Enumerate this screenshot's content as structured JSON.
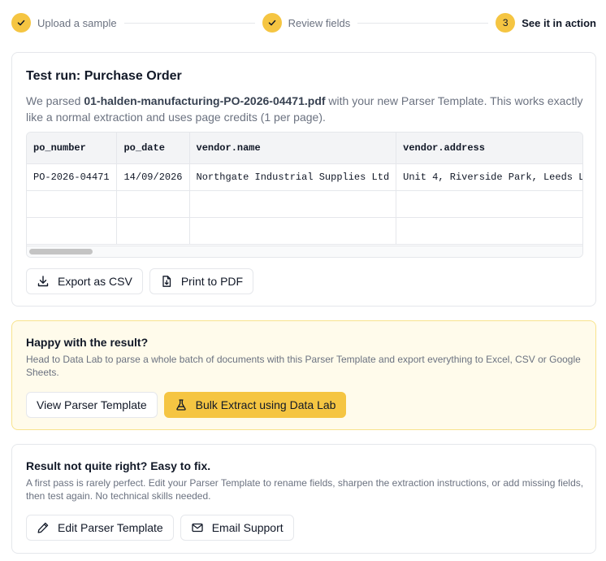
{
  "stepper": {
    "steps": [
      {
        "label": "Upload a sample",
        "state": "complete",
        "icon": "check-icon"
      },
      {
        "label": "Review fields",
        "state": "complete",
        "icon": "check-icon"
      },
      {
        "label": "See it in action",
        "state": "active",
        "number": "3"
      }
    ]
  },
  "test_run": {
    "title": "Test run: Purchase Order",
    "desc_prefix": "We parsed ",
    "filename": "01-halden-manufacturing-PO-2026-04471.pdf",
    "desc_suffix": " with your new Parser Template. This works exactly like a normal extraction and uses page credits (1 per page).",
    "table": {
      "columns": [
        "po_number",
        "po_date",
        "vendor.name",
        "vendor.address"
      ],
      "rows": [
        [
          "PO-2026-04471",
          "14/09/2026",
          "Northgate Industrial Supplies Ltd",
          "Unit 4, Riverside Park, Leeds L"
        ],
        [
          "",
          "",
          "",
          ""
        ],
        [
          "",
          "",
          "",
          ""
        ]
      ]
    },
    "buttons": {
      "export_csv": "Export as CSV",
      "print_pdf": "Print to PDF"
    }
  },
  "happy": {
    "title": "Happy with the result?",
    "desc": "Head to Data Lab to parse a whole batch of documents with this Parser Template and export everything to Excel, CSV or Google Sheets.",
    "buttons": {
      "view_template": "View Parser Template",
      "bulk_extract": "Bulk Extract using Data Lab"
    }
  },
  "fix": {
    "title": "Result not quite right? Easy to fix.",
    "desc": "A first pass is rarely perfect. Edit your Parser Template to rename fields, sharpen the extraction instructions, or add missing fields, then test again. No technical skills needed.",
    "buttons": {
      "edit_template": "Edit Parser Template",
      "email_support": "Email Support"
    }
  },
  "colors": {
    "accent": "#f5c542",
    "happy_bg": "#fffbeb",
    "happy_border": "#f8e38d",
    "muted_text": "#6b7280"
  }
}
